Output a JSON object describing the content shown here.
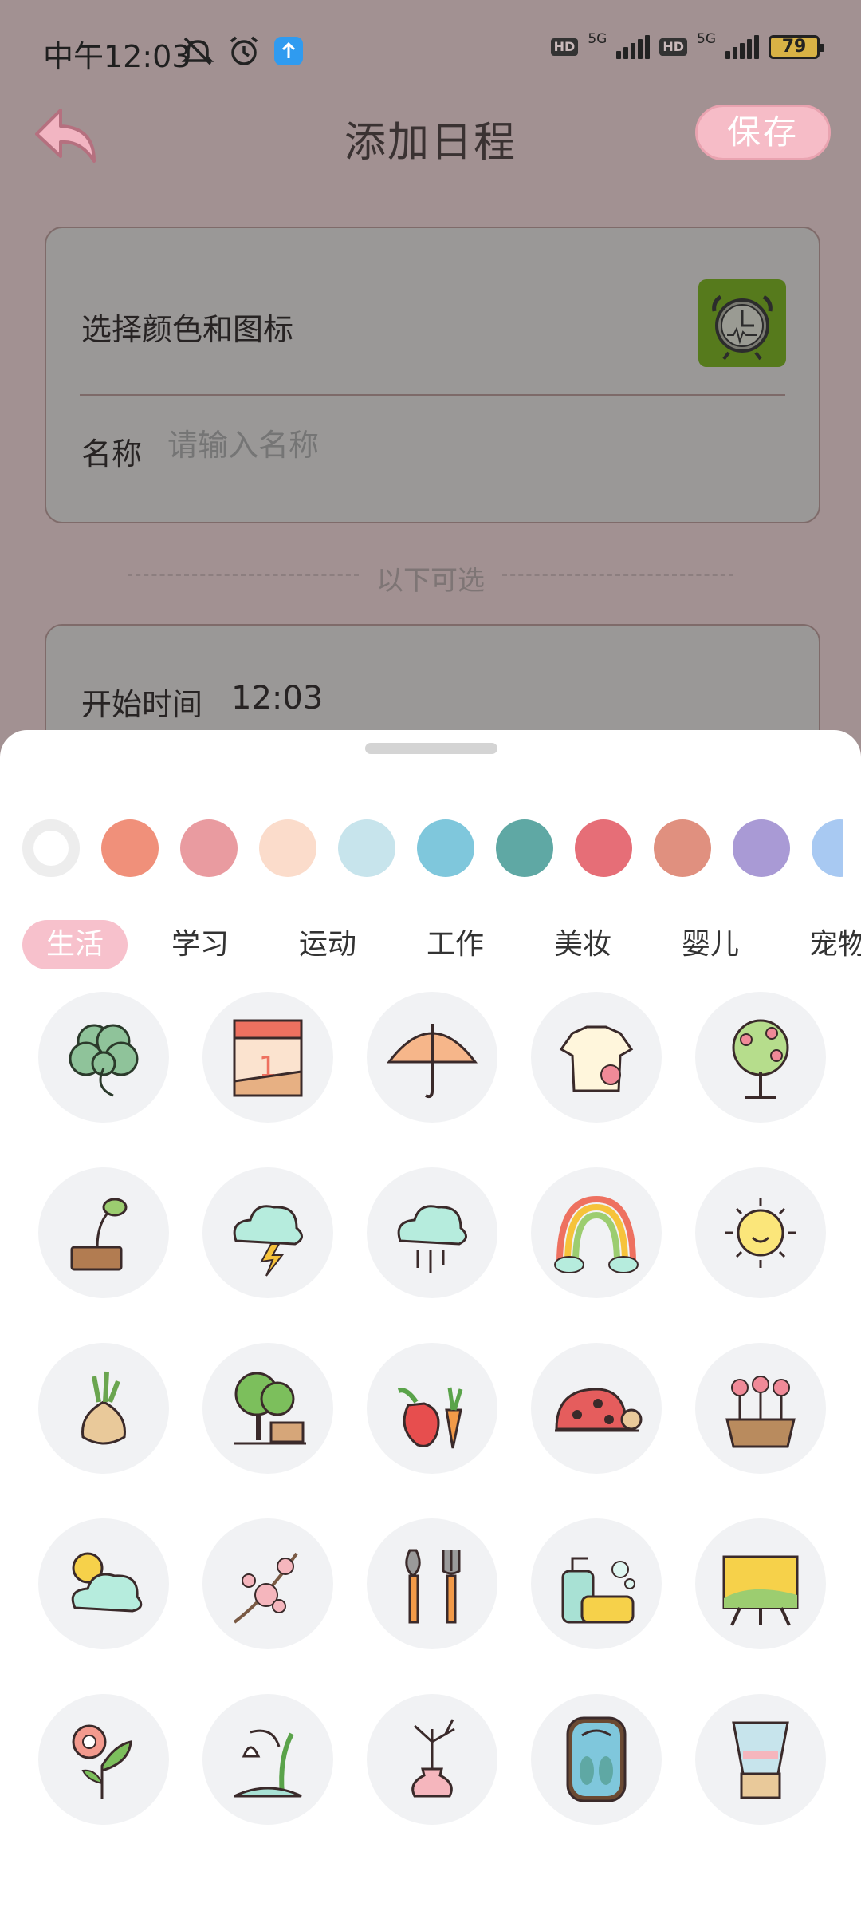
{
  "status": {
    "time": "中午12:03",
    "battery": "79",
    "network": "5G",
    "hd": "HD"
  },
  "header": {
    "title": "添加日程",
    "save_label": "保存"
  },
  "form": {
    "color_icon_label": "选择颜色和图标",
    "name_label": "名称",
    "name_placeholder": "请输入名称",
    "optional_label": "以下可选",
    "start_label": "开始时间",
    "start_value": "12:03"
  },
  "colors": [
    "#ffffff",
    "#f0907a",
    "#e99ba0",
    "#fbdccb",
    "#c7e4ec",
    "#7fc7dc",
    "#5fa8a4",
    "#e66e77",
    "#e0907f",
    "#a99ad5",
    "#a8c9f2"
  ],
  "tabs": [
    {
      "label": "生活",
      "active": true
    },
    {
      "label": "学习"
    },
    {
      "label": "运动"
    },
    {
      "label": "工作"
    },
    {
      "label": "美妆"
    },
    {
      "label": "婴儿"
    },
    {
      "label": "宠物"
    }
  ],
  "icons": [
    "clover-icon",
    "calendar-icon",
    "umbrella-icon",
    "shirt-icon",
    "tree-icon",
    "sprout-icon",
    "thunder-cloud-icon",
    "rain-cloud-icon",
    "rainbow-icon",
    "sun-icon",
    "onion-icon",
    "tree-shovel-icon",
    "vegetables-icon",
    "snail-icon",
    "flower-pot-icon",
    "cloud-sun-icon",
    "blossom-icon",
    "garden-tools-icon",
    "soap-icon",
    "easel-icon",
    "flower-icon",
    "snowdrop-icon",
    "vase-icon",
    "scale-icon",
    "blender-icon"
  ]
}
